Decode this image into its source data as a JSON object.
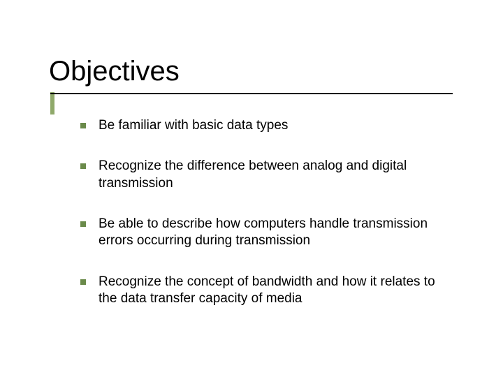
{
  "title": "Objectives",
  "items": [
    "Be familiar with basic data types",
    "Recognize the difference between analog and digital transmission",
    "Be able to describe how computers handle transmission errors occurring during transmission",
    "Recognize the concept of bandwidth and how it relates to the data transfer capacity of media"
  ]
}
